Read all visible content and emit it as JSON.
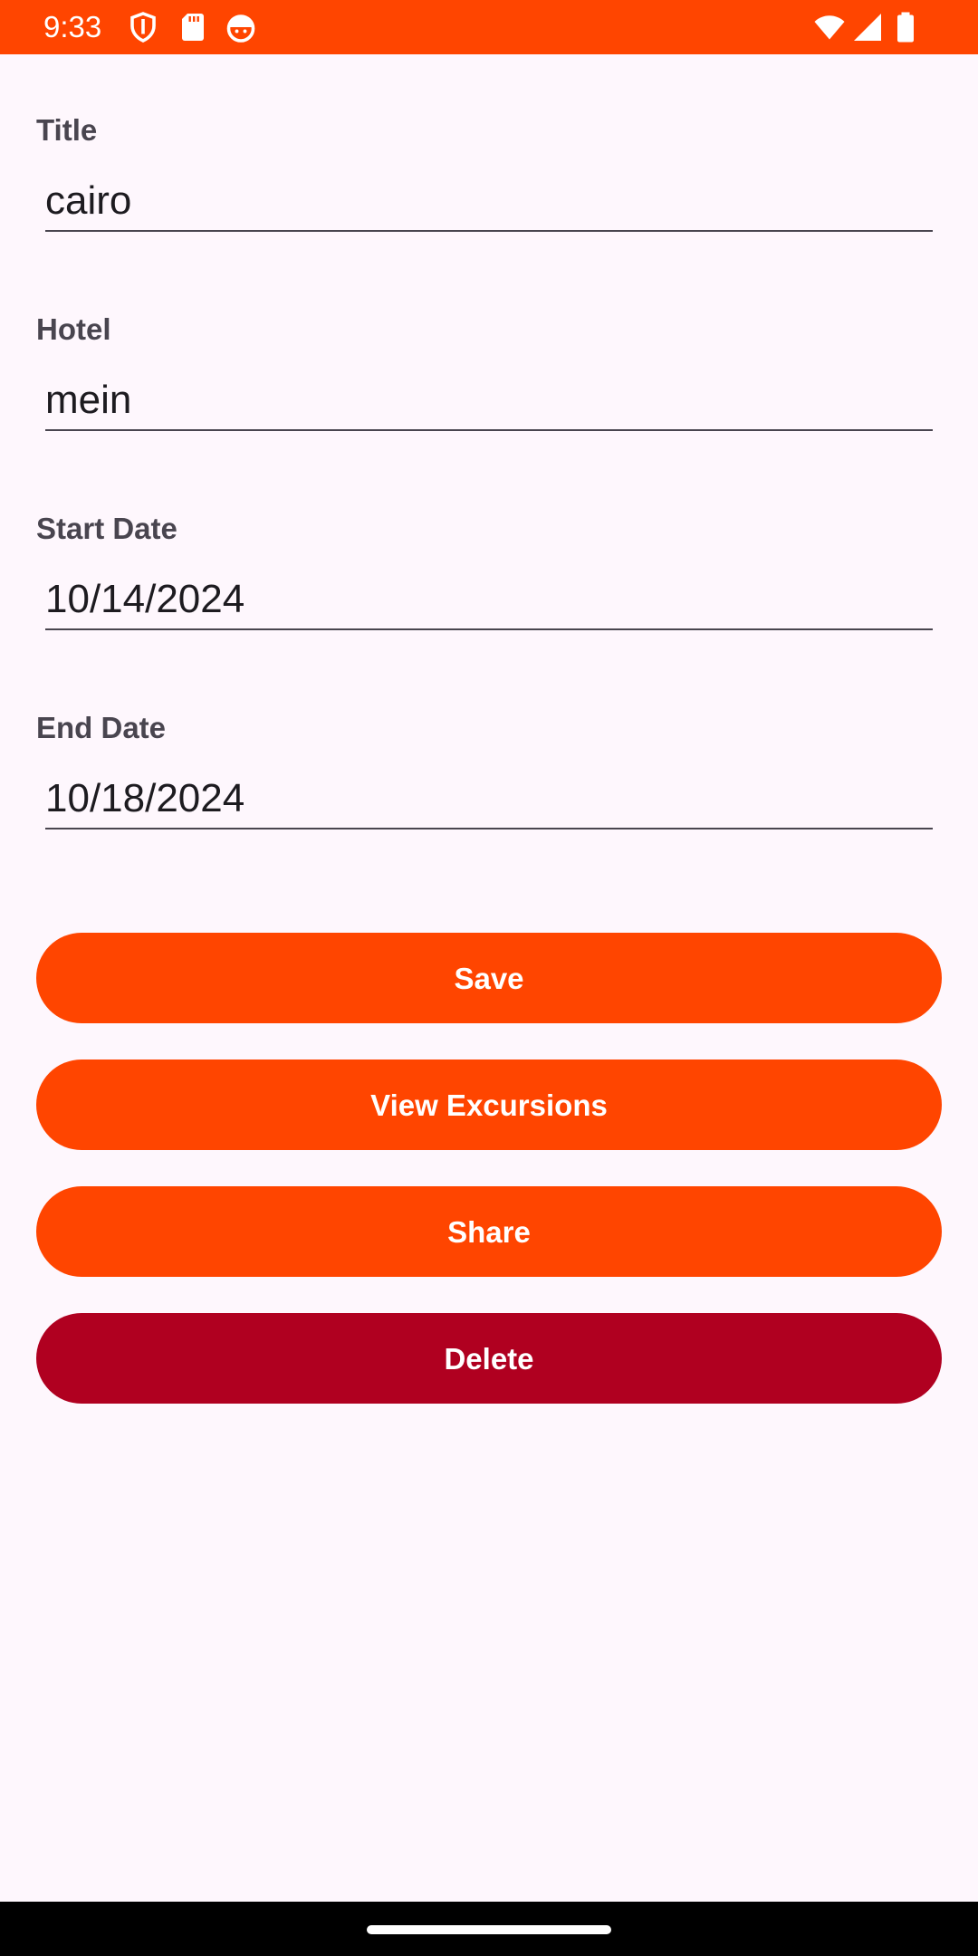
{
  "status_bar": {
    "time": "9:33",
    "background_color": "#FF4500",
    "left_icons": [
      "shield-icon",
      "sd-card-icon",
      "android-face-icon"
    ],
    "right_icons": [
      "wifi-icon",
      "cell-signal-icon",
      "battery-icon"
    ]
  },
  "form": {
    "title": {
      "label": "Title",
      "value": "cairo"
    },
    "hotel": {
      "label": "Hotel",
      "value": "mein"
    },
    "start_date": {
      "label": "Start Date",
      "value": "10/14/2024"
    },
    "end_date": {
      "label": "End Date",
      "value": "10/18/2024"
    }
  },
  "buttons": {
    "save": {
      "label": "Save",
      "color": "#FF4500"
    },
    "view_excursions": {
      "label": "View Excursions",
      "color": "#FF4500"
    },
    "share": {
      "label": "Share",
      "color": "#FF4500"
    },
    "delete": {
      "label": "Delete",
      "color": "#B00020"
    }
  },
  "colors": {
    "background": "#FEF7FD",
    "label_text": "#49454F",
    "input_text": "#1D1B20"
  }
}
